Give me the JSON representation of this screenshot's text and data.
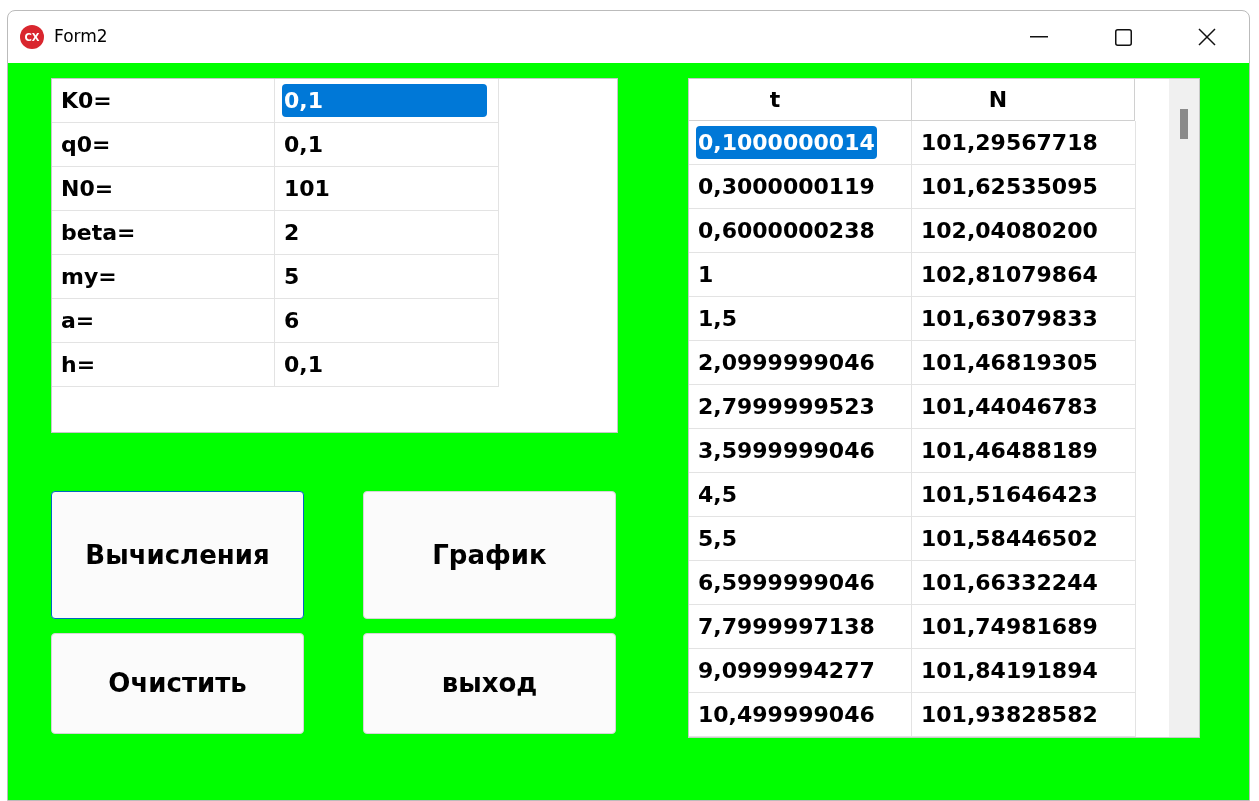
{
  "window": {
    "title": "Form2",
    "icon_label": "CX"
  },
  "params": [
    {
      "label": "K0=",
      "value": "0,1",
      "selected": true
    },
    {
      "label": "q0=",
      "value": "0,1",
      "selected": false
    },
    {
      "label": "N0=",
      "value": "101",
      "selected": false
    },
    {
      "label": "beta=",
      "value": "2",
      "selected": false
    },
    {
      "label": "my=",
      "value": "5",
      "selected": false
    },
    {
      "label": "a=",
      "value": "6",
      "selected": false
    },
    {
      "label": "h=",
      "value": "0,1",
      "selected": false
    }
  ],
  "buttons": [
    {
      "label": "Вычисления",
      "focused": true
    },
    {
      "label": "График",
      "focused": false
    },
    {
      "label": "Очистить",
      "focused": false
    },
    {
      "label": "выход",
      "focused": false
    }
  ],
  "results": {
    "columns": [
      "t",
      "N"
    ],
    "rows": [
      {
        "t": "0,1000000014",
        "n": "101,29567718",
        "selected": true
      },
      {
        "t": "0,3000000119",
        "n": "101,62535095",
        "selected": false
      },
      {
        "t": "0,6000000238",
        "n": "102,04080200",
        "selected": false
      },
      {
        "t": "1",
        "n": "102,81079864",
        "selected": false
      },
      {
        "t": "1,5",
        "n": "101,63079833",
        "selected": false
      },
      {
        "t": "2,0999999046",
        "n": "101,46819305",
        "selected": false
      },
      {
        "t": "2,7999999523",
        "n": "101,44046783",
        "selected": false
      },
      {
        "t": "3,5999999046",
        "n": "101,46488189",
        "selected": false
      },
      {
        "t": "4,5",
        "n": "101,51646423",
        "selected": false
      },
      {
        "t": "5,5",
        "n": "101,58446502",
        "selected": false
      },
      {
        "t": "6,5999999046",
        "n": "101,66332244",
        "selected": false
      },
      {
        "t": "7,7999997138",
        "n": "101,74981689",
        "selected": false
      },
      {
        "t": "9,0999994277",
        "n": "101,84191894",
        "selected": false
      },
      {
        "t": "10,499999046",
        "n": "101,93828582",
        "selected": false
      }
    ]
  }
}
